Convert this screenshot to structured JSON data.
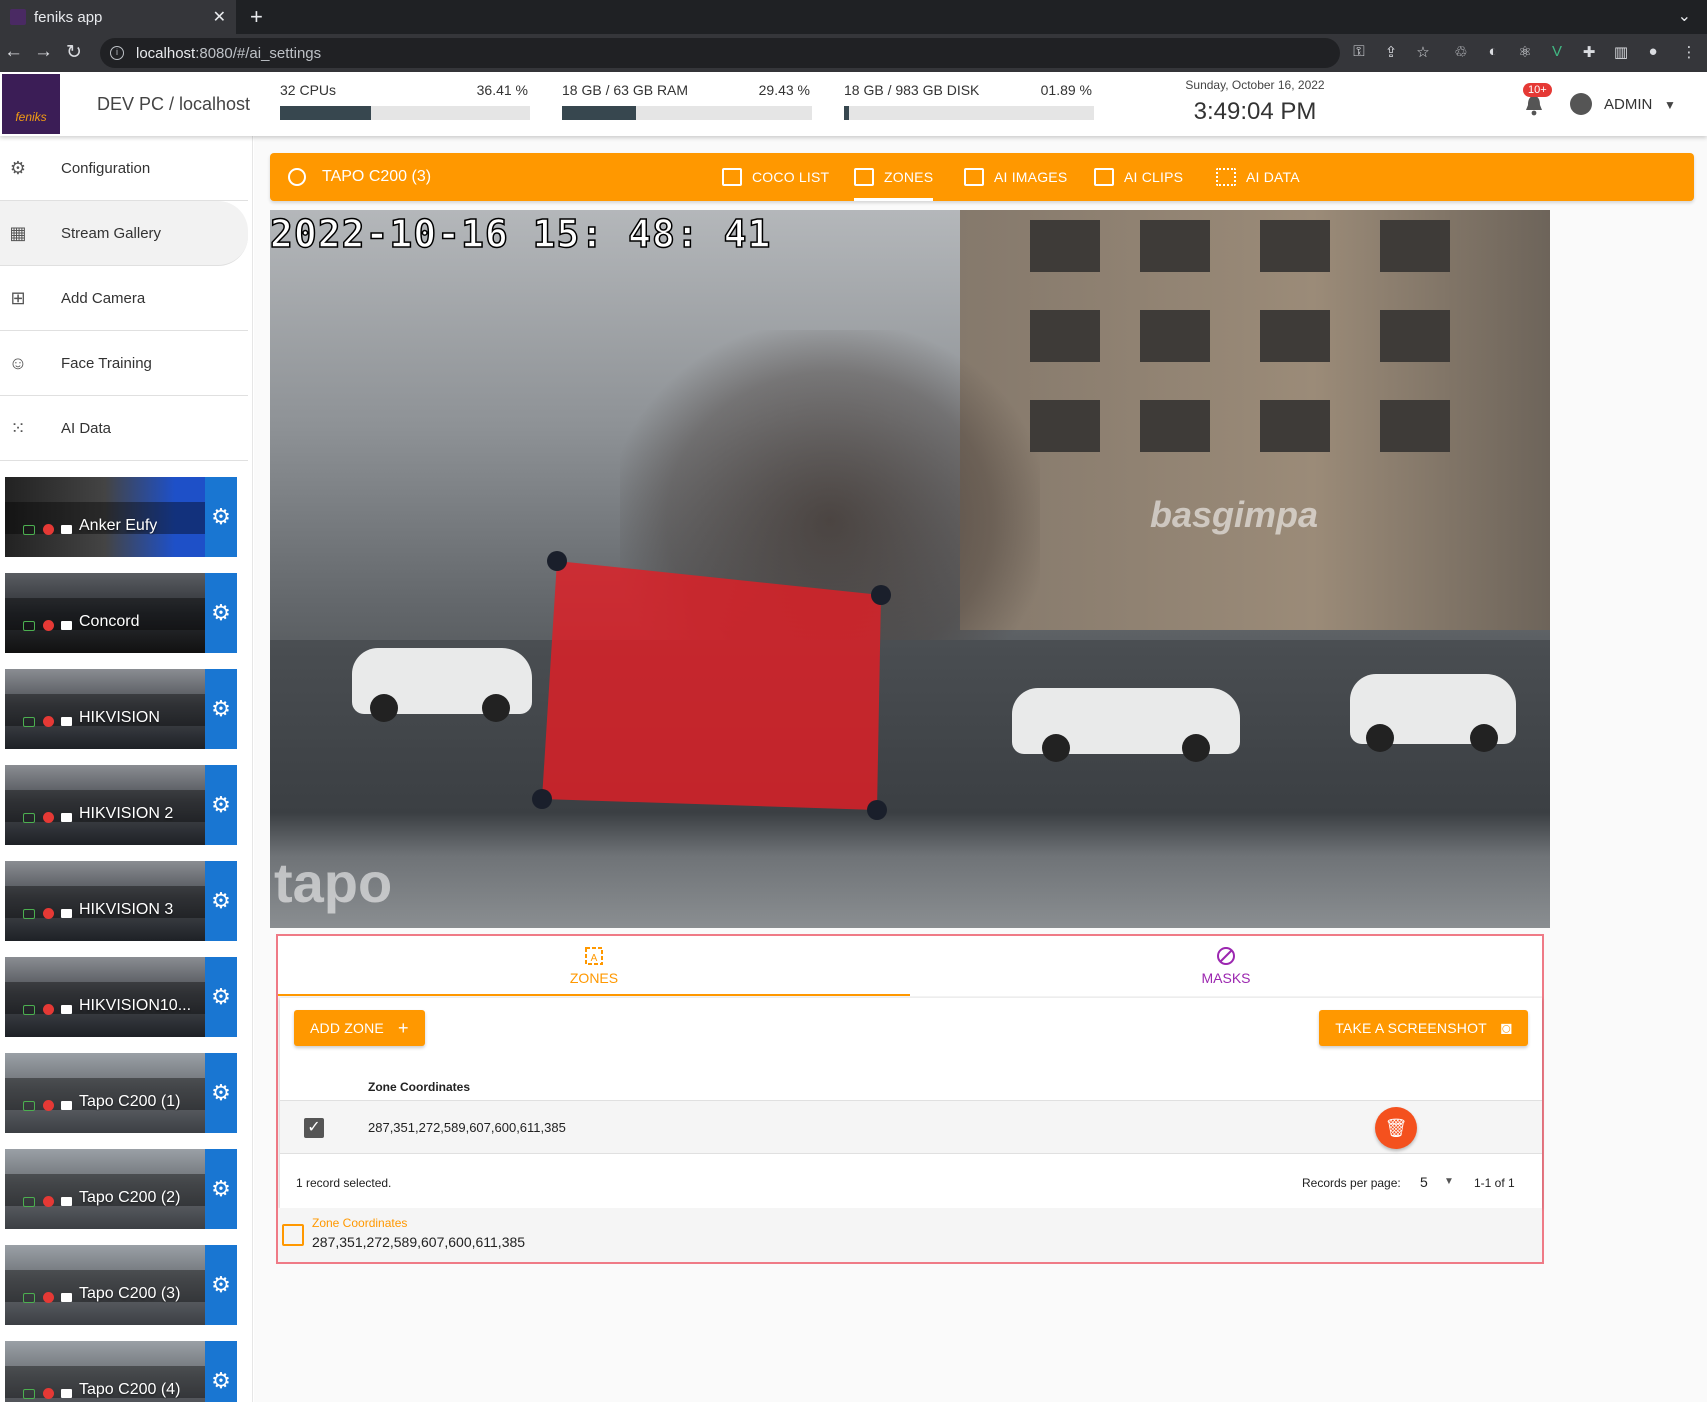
{
  "browser": {
    "tab_title": "feniks app",
    "url_host": "localhost",
    "url_rest": ":8080/#/ai_settings"
  },
  "header": {
    "logo_text": "feniks",
    "hostname": "DEV PC / localhost",
    "meters": [
      {
        "label": "32 CPUs",
        "value": "36.41 %",
        "fill": 36.41
      },
      {
        "label": "18 GB / 63 GB RAM",
        "value": "29.43 %",
        "fill": 29.43
      },
      {
        "label": "18 GB / 983 GB DISK",
        "value": "01.89 %",
        "fill": 1.89
      }
    ],
    "date": "Sunday, October 16, 2022",
    "time": "3:49:04 PM",
    "notif_badge": "10+",
    "user": "ADMIN"
  },
  "sidebar": {
    "nav": [
      {
        "label": "Configuration",
        "icon": "gear-icon"
      },
      {
        "label": "Stream Gallery",
        "icon": "grid-icon"
      },
      {
        "label": "Add Camera",
        "icon": "add-box-icon"
      },
      {
        "label": "Face Training",
        "icon": "face-icon"
      },
      {
        "label": "AI Data",
        "icon": "dots-grid-icon"
      }
    ],
    "cameras": [
      {
        "name": "Anker Eufy"
      },
      {
        "name": "Concord"
      },
      {
        "name": "HIKVISION"
      },
      {
        "name": "HIKVISION 2"
      },
      {
        "name": "HIKVISION 3"
      },
      {
        "name": "HIKVISION10..."
      },
      {
        "name": "Tapo C200 (1)"
      },
      {
        "name": "Tapo C200 (2)"
      },
      {
        "name": "Tapo C200 (3)"
      },
      {
        "name": "Tapo C200 (4)"
      }
    ]
  },
  "camera_bar": {
    "title": "TAPO C200 (3)",
    "tabs": [
      "COCO LIST",
      "ZONES",
      "AI IMAGES",
      "AI CLIPS",
      "AI DATA"
    ],
    "selected_tab": "ZONES"
  },
  "video": {
    "timestamp": "2022-10-16  15: 48: 41",
    "watermark": "tapo",
    "storefront_sign": "basgimpa",
    "zone_color": "#e01e26"
  },
  "zone_editor": {
    "tabs": [
      "ZONES",
      "MASKS"
    ],
    "add_zone_label": "ADD ZONE",
    "screenshot_label": "TAKE A SCREENSHOT",
    "column_header": "Zone Coordinates",
    "rows": [
      {
        "coords": "287,351,272,589,607,600,611,385",
        "selected": true
      }
    ],
    "selection_text": "1 record selected.",
    "records_per_page_label": "Records per page:",
    "records_per_page": "5",
    "range_text": "1-1 of 1",
    "summary_label": "Zone Coordinates",
    "summary_value": "287,351,272,589,607,600,611,385"
  },
  "colors": {
    "accent": "#ff9800",
    "masks": "#9c27b0",
    "gear_blue": "#1976d2",
    "delete": "#f4511e"
  }
}
